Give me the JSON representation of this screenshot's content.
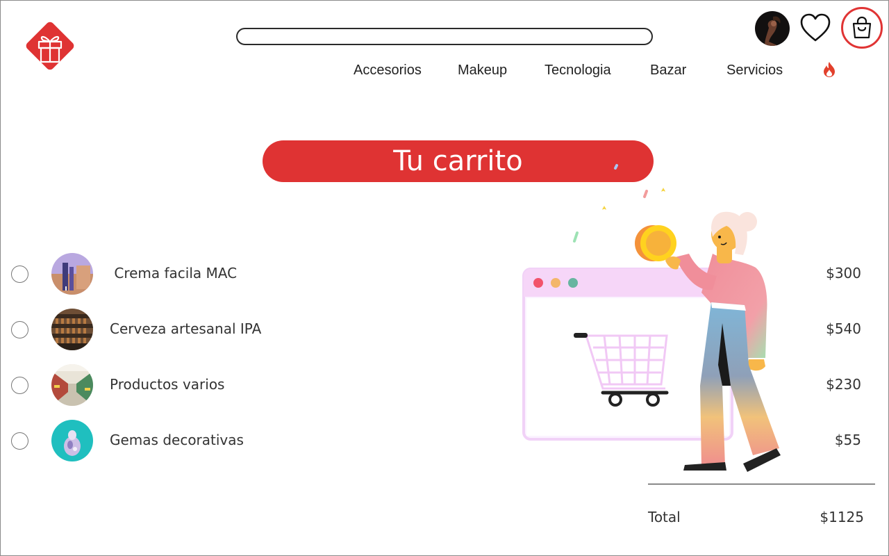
{
  "header": {
    "search": {
      "placeholder": "",
      "value": ""
    },
    "nav": [
      "Accesorios",
      "Makeup",
      "Tecnologia",
      "Bazar",
      "Servicios"
    ],
    "icons": {
      "logo": "gift-logo",
      "avatar": "avatar",
      "favorites": "heart-icon",
      "cart": "shopping-bag-icon",
      "hot": "fire-icon"
    }
  },
  "page": {
    "title": "Tu carrito"
  },
  "cart": {
    "items": [
      {
        "name": " Crema facila MAC",
        "price": "$300"
      },
      {
        "name": "Cerveza artesanal IPA",
        "price": "$540"
      },
      {
        "name": "Productos varios",
        "price": "$230"
      },
      {
        "name": "Gemas decorativas",
        "price": "$55"
      }
    ],
    "total_label": "Total",
    "total_value": "$1125"
  },
  "colors": {
    "accent": "#df3333",
    "text": "#333333"
  }
}
